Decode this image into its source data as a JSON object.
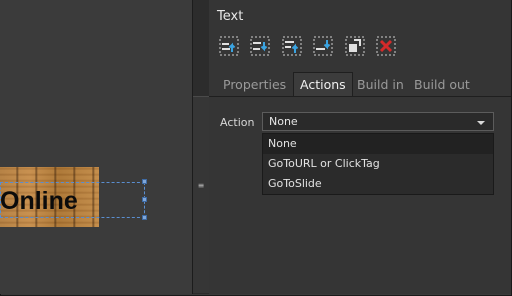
{
  "stage": {
    "banner_text": "Online",
    "splitter_glyph": "≡"
  },
  "panel": {
    "title": "Text",
    "toolbar": [
      {
        "name": "bring-to-front-icon",
        "color": "#3aa3e0"
      },
      {
        "name": "send-to-back-icon",
        "color": "#3aa3e0"
      },
      {
        "name": "bring-forward-icon",
        "color": "#3aa3e0"
      },
      {
        "name": "send-backward-icon",
        "color": "#3aa3e0"
      },
      {
        "name": "duplicate-icon",
        "color": "#d0d0d0"
      },
      {
        "name": "delete-icon",
        "color": "#d42a2a"
      }
    ],
    "tabs": [
      {
        "label": "Properties",
        "active": false
      },
      {
        "label": "Actions",
        "active": true
      },
      {
        "label": "Build in",
        "active": false
      },
      {
        "label": "Build out",
        "active": false
      }
    ],
    "action": {
      "label": "Action",
      "selected": "None",
      "options": [
        "None",
        "GoToURL or ClickTag",
        "GoToSlide"
      ]
    }
  }
}
